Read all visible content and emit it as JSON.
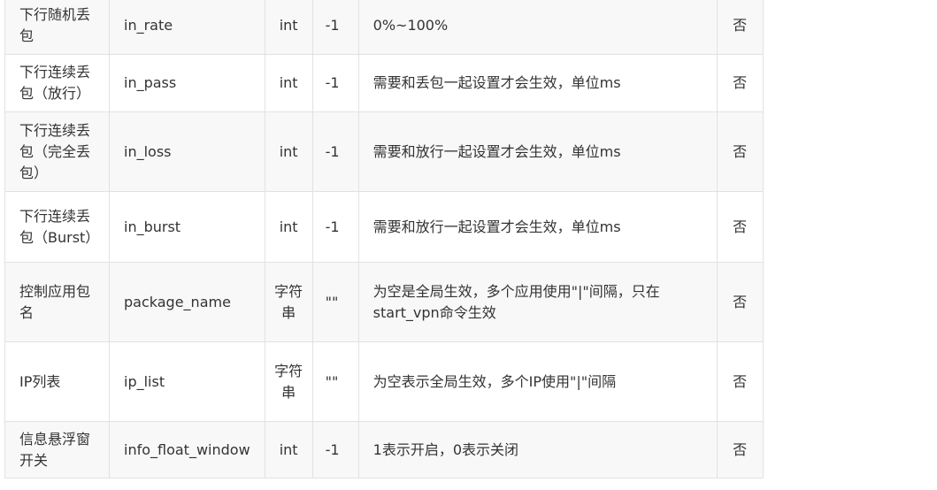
{
  "table": {
    "rows": [
      {
        "name": "下行随机丢包",
        "key": "in_rate",
        "type": "int",
        "default": "-1",
        "desc": "0%~100%",
        "required": "否"
      },
      {
        "name": "下行连续丢包（放行）",
        "key": "in_pass",
        "type": "int",
        "default": "-1",
        "desc": "需要和丢包一起设置才会生效，单位ms",
        "required": "否"
      },
      {
        "name": "下行连续丢包（完全丢包）",
        "key": "in_loss",
        "type": "int",
        "default": "-1",
        "desc": "需要和放行一起设置才会生效，单位ms",
        "required": "否"
      },
      {
        "name": "下行连续丢包（Burst）",
        "key": "in_burst",
        "type": "int",
        "default": "-1",
        "desc": "需要和放行一起设置才会生效，单位ms",
        "required": "否"
      },
      {
        "name": "控制应用包名",
        "key": "package_name",
        "type": "字符串",
        "default": "\"\"",
        "desc": "为空是全局生效，多个应用使用\"|\"间隔，只在start_vpn命令生效",
        "required": "否"
      },
      {
        "name": "IP列表",
        "key": "ip_list",
        "type": "字符串",
        "default": "\"\"",
        "desc": "为空表示全局生效，多个IP使用\"|\"间隔",
        "required": "否"
      },
      {
        "name": "信息悬浮窗开关",
        "key": "info_float_window",
        "type": "int",
        "default": "-1",
        "desc": "1表示开启，0表示关闭",
        "required": "否"
      }
    ]
  }
}
